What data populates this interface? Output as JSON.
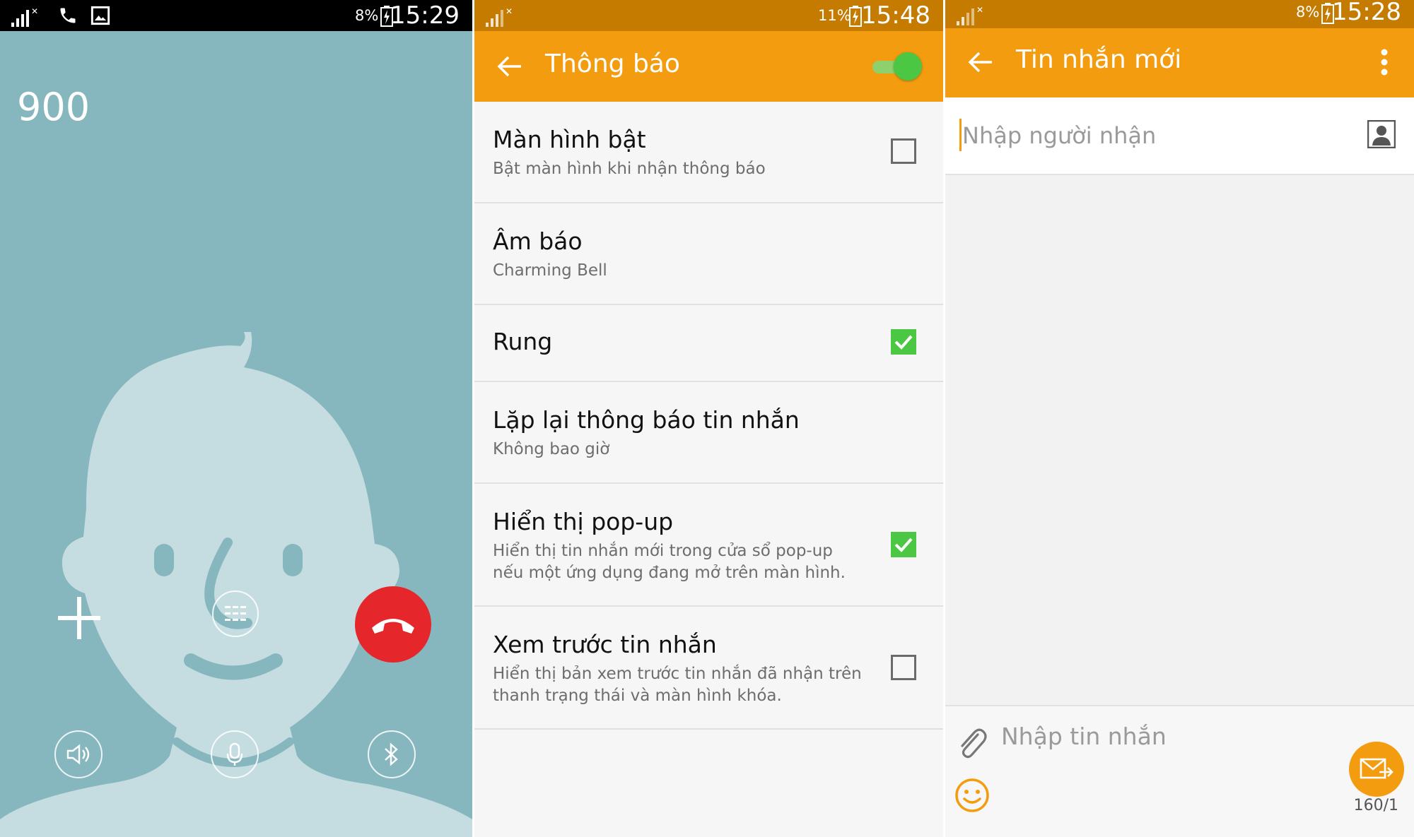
{
  "call_screen": {
    "status_time": "15:29",
    "status_battery": "8%",
    "number": "900",
    "colors": {
      "background": "#87b7be",
      "avatar": "#c5dde1",
      "end_call": "#e5262b"
    },
    "icons": [
      "signal-icon",
      "phone-icon",
      "image-icon",
      "battery-icon",
      "add-call-icon",
      "keypad-icon",
      "end-call-icon",
      "speaker-icon",
      "mic-icon",
      "bluetooth-icon"
    ]
  },
  "notification_settings": {
    "status_time": "15:48",
    "status_battery": "11%",
    "title": "Thông báo",
    "toggle_on": true,
    "items": [
      {
        "title": "Màn hình bật",
        "subtitle": "Bật màn hình khi nhận thông báo",
        "checked": false
      },
      {
        "title": "Âm báo",
        "subtitle": "Charming Bell"
      },
      {
        "title": "Rung",
        "checked": true
      },
      {
        "title": "Lặp lại thông báo tin nhắn",
        "subtitle": "Không bao giờ"
      },
      {
        "title": "Hiển thị pop-up",
        "subtitle": "Hiển thị tin nhắn mới trong cửa sổ pop-up nếu một ứng dụng đang mở trên màn hình.",
        "checked": true
      },
      {
        "title": "Xem trước tin nhắn",
        "subtitle": "Hiển thị bản xem trước tin nhắn đã nhận trên thanh trạng thái và màn hình khóa.",
        "checked": false
      }
    ],
    "colors": {
      "app_bar": "#f39c0f",
      "status_bar": "#c57a00",
      "check": "#4bc744"
    }
  },
  "new_message": {
    "status_time": "15:28",
    "status_battery": "8%",
    "title": "Tin nhắn mới",
    "recipient_placeholder": "Nhập người nhận",
    "message_placeholder": "Nhập tin nhắn",
    "char_counter": "160/1",
    "icons": [
      "back-arrow-icon",
      "more-options-icon",
      "contact-icon",
      "attach-icon",
      "emoji-icon",
      "send-icon"
    ]
  }
}
